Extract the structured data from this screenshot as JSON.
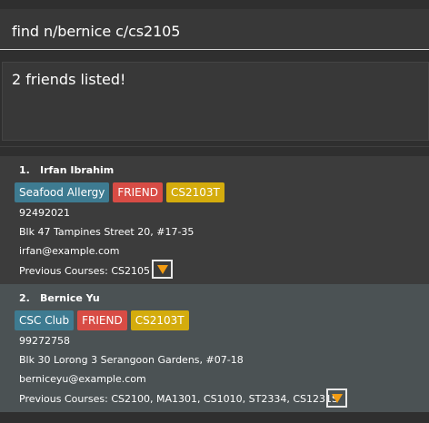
{
  "command": {
    "value": "find n/bernice c/cs2105"
  },
  "result": {
    "message": "2 friends listed!"
  },
  "colors": {
    "tag_blue": "#3e7b91",
    "tag_red": "#d84c45",
    "tag_yellow": "#d4ac0d",
    "expand_arrow": "#f39c12"
  },
  "persons": [
    {
      "index": "1.",
      "name": "Irfan Ibrahim",
      "tags": [
        {
          "label": "Seafood Allergy",
          "color": "blue"
        },
        {
          "label": "FRIEND",
          "color": "red"
        },
        {
          "label": "CS2103T",
          "color": "yellow"
        }
      ],
      "phone": "92492021",
      "address": "Blk 47 Tampines Street 20, #17-35",
      "email": "irfan@example.com",
      "previous_courses": "Previous Courses: CS2105",
      "expand_icon": "triangle-down-icon"
    },
    {
      "index": "2.",
      "name": "Bernice Yu",
      "tags": [
        {
          "label": "CSC Club",
          "color": "blue"
        },
        {
          "label": "FRIEND",
          "color": "red"
        },
        {
          "label": "CS2103T",
          "color": "yellow"
        }
      ],
      "phone": "99272758",
      "address": "Blk 30 Lorong 3 Serangoon Gardens, #07-18",
      "email": "berniceyu@example.com",
      "previous_courses": "Previous Courses: CS2100, MA1301, CS1010, ST2334, CS1231S",
      "expand_icon": "triangle-down-icon"
    }
  ]
}
